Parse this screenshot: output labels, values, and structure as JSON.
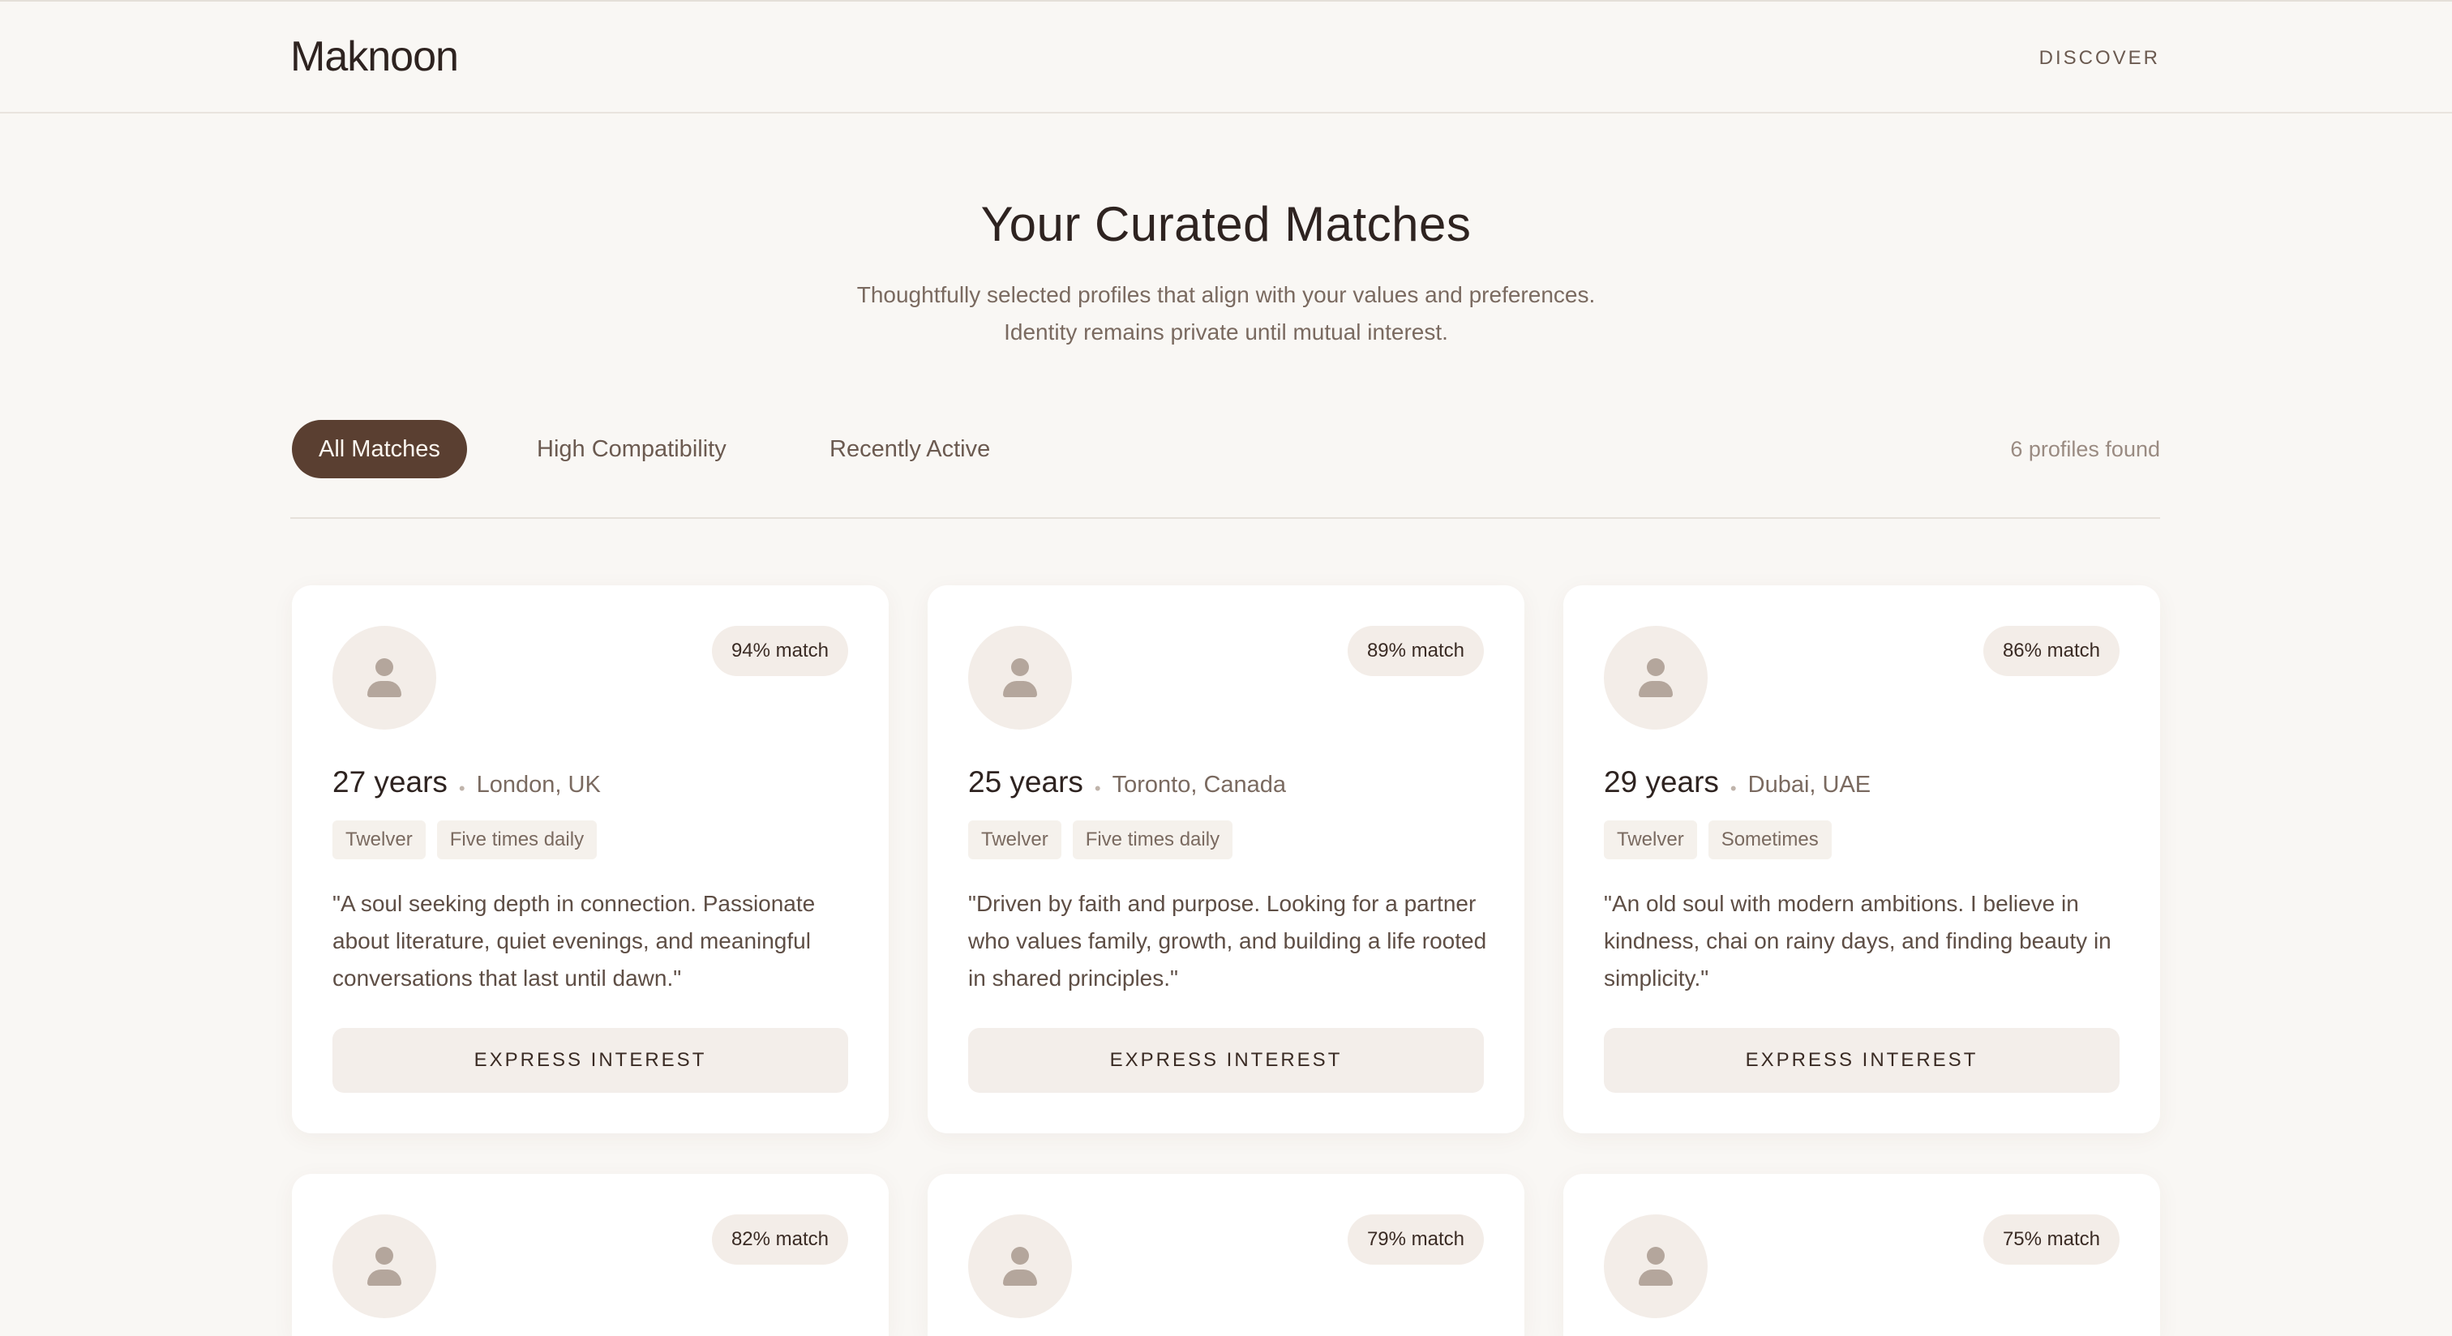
{
  "brand": {
    "name": "Maknoon"
  },
  "nav": {
    "discover": "DISCOVER"
  },
  "hero": {
    "title": "Your Curated Matches",
    "line1": "Thoughtfully selected profiles that align with your values and preferences.",
    "line2": "Identity remains private until mutual interest."
  },
  "filters": {
    "tabs": [
      "All Matches",
      "High Compatibility",
      "Recently Active"
    ],
    "active": "All Matches",
    "count": "6 profiles found"
  },
  "profiles": [
    {
      "match": "94% match",
      "age": "27 years",
      "location": "London, UK",
      "tags": [
        "Twelver",
        "Five times daily"
      ],
      "quote": "\"A soul seeking depth in connection. Passionate about literature, quiet evenings, and meaningful conversations that last until dawn.\"",
      "cta": "EXPRESS INTEREST"
    },
    {
      "match": "89% match",
      "age": "25 years",
      "location": "Toronto, Canada",
      "tags": [
        "Twelver",
        "Five times daily"
      ],
      "quote": "\"Driven by faith and purpose. Looking for a partner who values family, growth, and building a life rooted in shared principles.\"",
      "cta": "EXPRESS INTEREST"
    },
    {
      "match": "86% match",
      "age": "29 years",
      "location": "Dubai, UAE",
      "tags": [
        "Twelver",
        "Sometimes"
      ],
      "quote": "\"An old soul with modern ambitions. I believe in kindness, chai on rainy days, and finding beauty in simplicity.\"",
      "cta": "EXPRESS INTEREST"
    },
    {
      "match": "82% match"
    },
    {
      "match": "79% match"
    },
    {
      "match": "75% match"
    }
  ],
  "colors": {
    "accent": "#5a3f31",
    "background": "#f9f7f4",
    "card": "#ffffff"
  }
}
